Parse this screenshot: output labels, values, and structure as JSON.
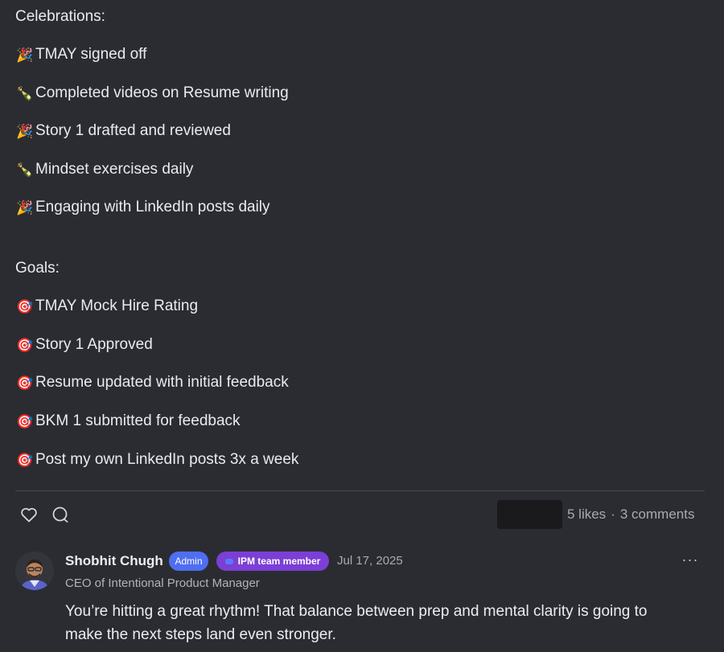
{
  "post": {
    "celebrations_heading": "Celebrations:",
    "celebrations": [
      {
        "emoji": "🎉",
        "icon": "party-popper-icon",
        "text": "TMAY signed off"
      },
      {
        "emoji": "🍾",
        "icon": "champagne-icon",
        "text": "Completed videos on Resume writing"
      },
      {
        "emoji": "🎉",
        "icon": "party-popper-icon",
        "text": "Story 1 drafted and reviewed"
      },
      {
        "emoji": "🍾",
        "icon": "champagne-icon",
        "text": "Mindset exercises daily"
      },
      {
        "emoji": "🎉",
        "icon": "party-popper-icon",
        "text": "Engaging with LinkedIn posts daily"
      }
    ],
    "goals_heading": "Goals:",
    "goals": [
      {
        "emoji": "🎯",
        "icon": "target-icon",
        "text": "TMAY Mock Hire Rating"
      },
      {
        "emoji": "🎯",
        "icon": "target-icon",
        "text": "Story 1 Approved"
      },
      {
        "emoji": "🎯",
        "icon": "target-icon",
        "text": "Resume updated with initial feedback"
      },
      {
        "emoji": "🎯",
        "icon": "target-icon",
        "text": "BKM 1 submitted for feedback"
      },
      {
        "emoji": "🎯",
        "icon": "target-icon",
        "text": "Post my own LinkedIn posts 3x a week"
      }
    ]
  },
  "actions": {
    "like_icon": "heart-icon",
    "comment_icon": "comment-bubble-icon",
    "likes": "5 likes",
    "separator": "·",
    "comments": "3 comments"
  },
  "comment": {
    "author": "Shobhit Chugh",
    "admin_badge": "Admin",
    "team_badge": "IPM team member",
    "date": "Jul 17, 2025",
    "author_title": "CEO of Intentional Product Manager",
    "text": "You’re hitting a great rhythm! That balance between prep and mental clarity is going to make the next steps land even stronger.",
    "more_label": "···"
  },
  "colors": {
    "background": "#2b2c32",
    "admin_badge": "#4f6ef0",
    "team_badge": "#7b3fd6",
    "muted_text": "#a9aab0"
  }
}
